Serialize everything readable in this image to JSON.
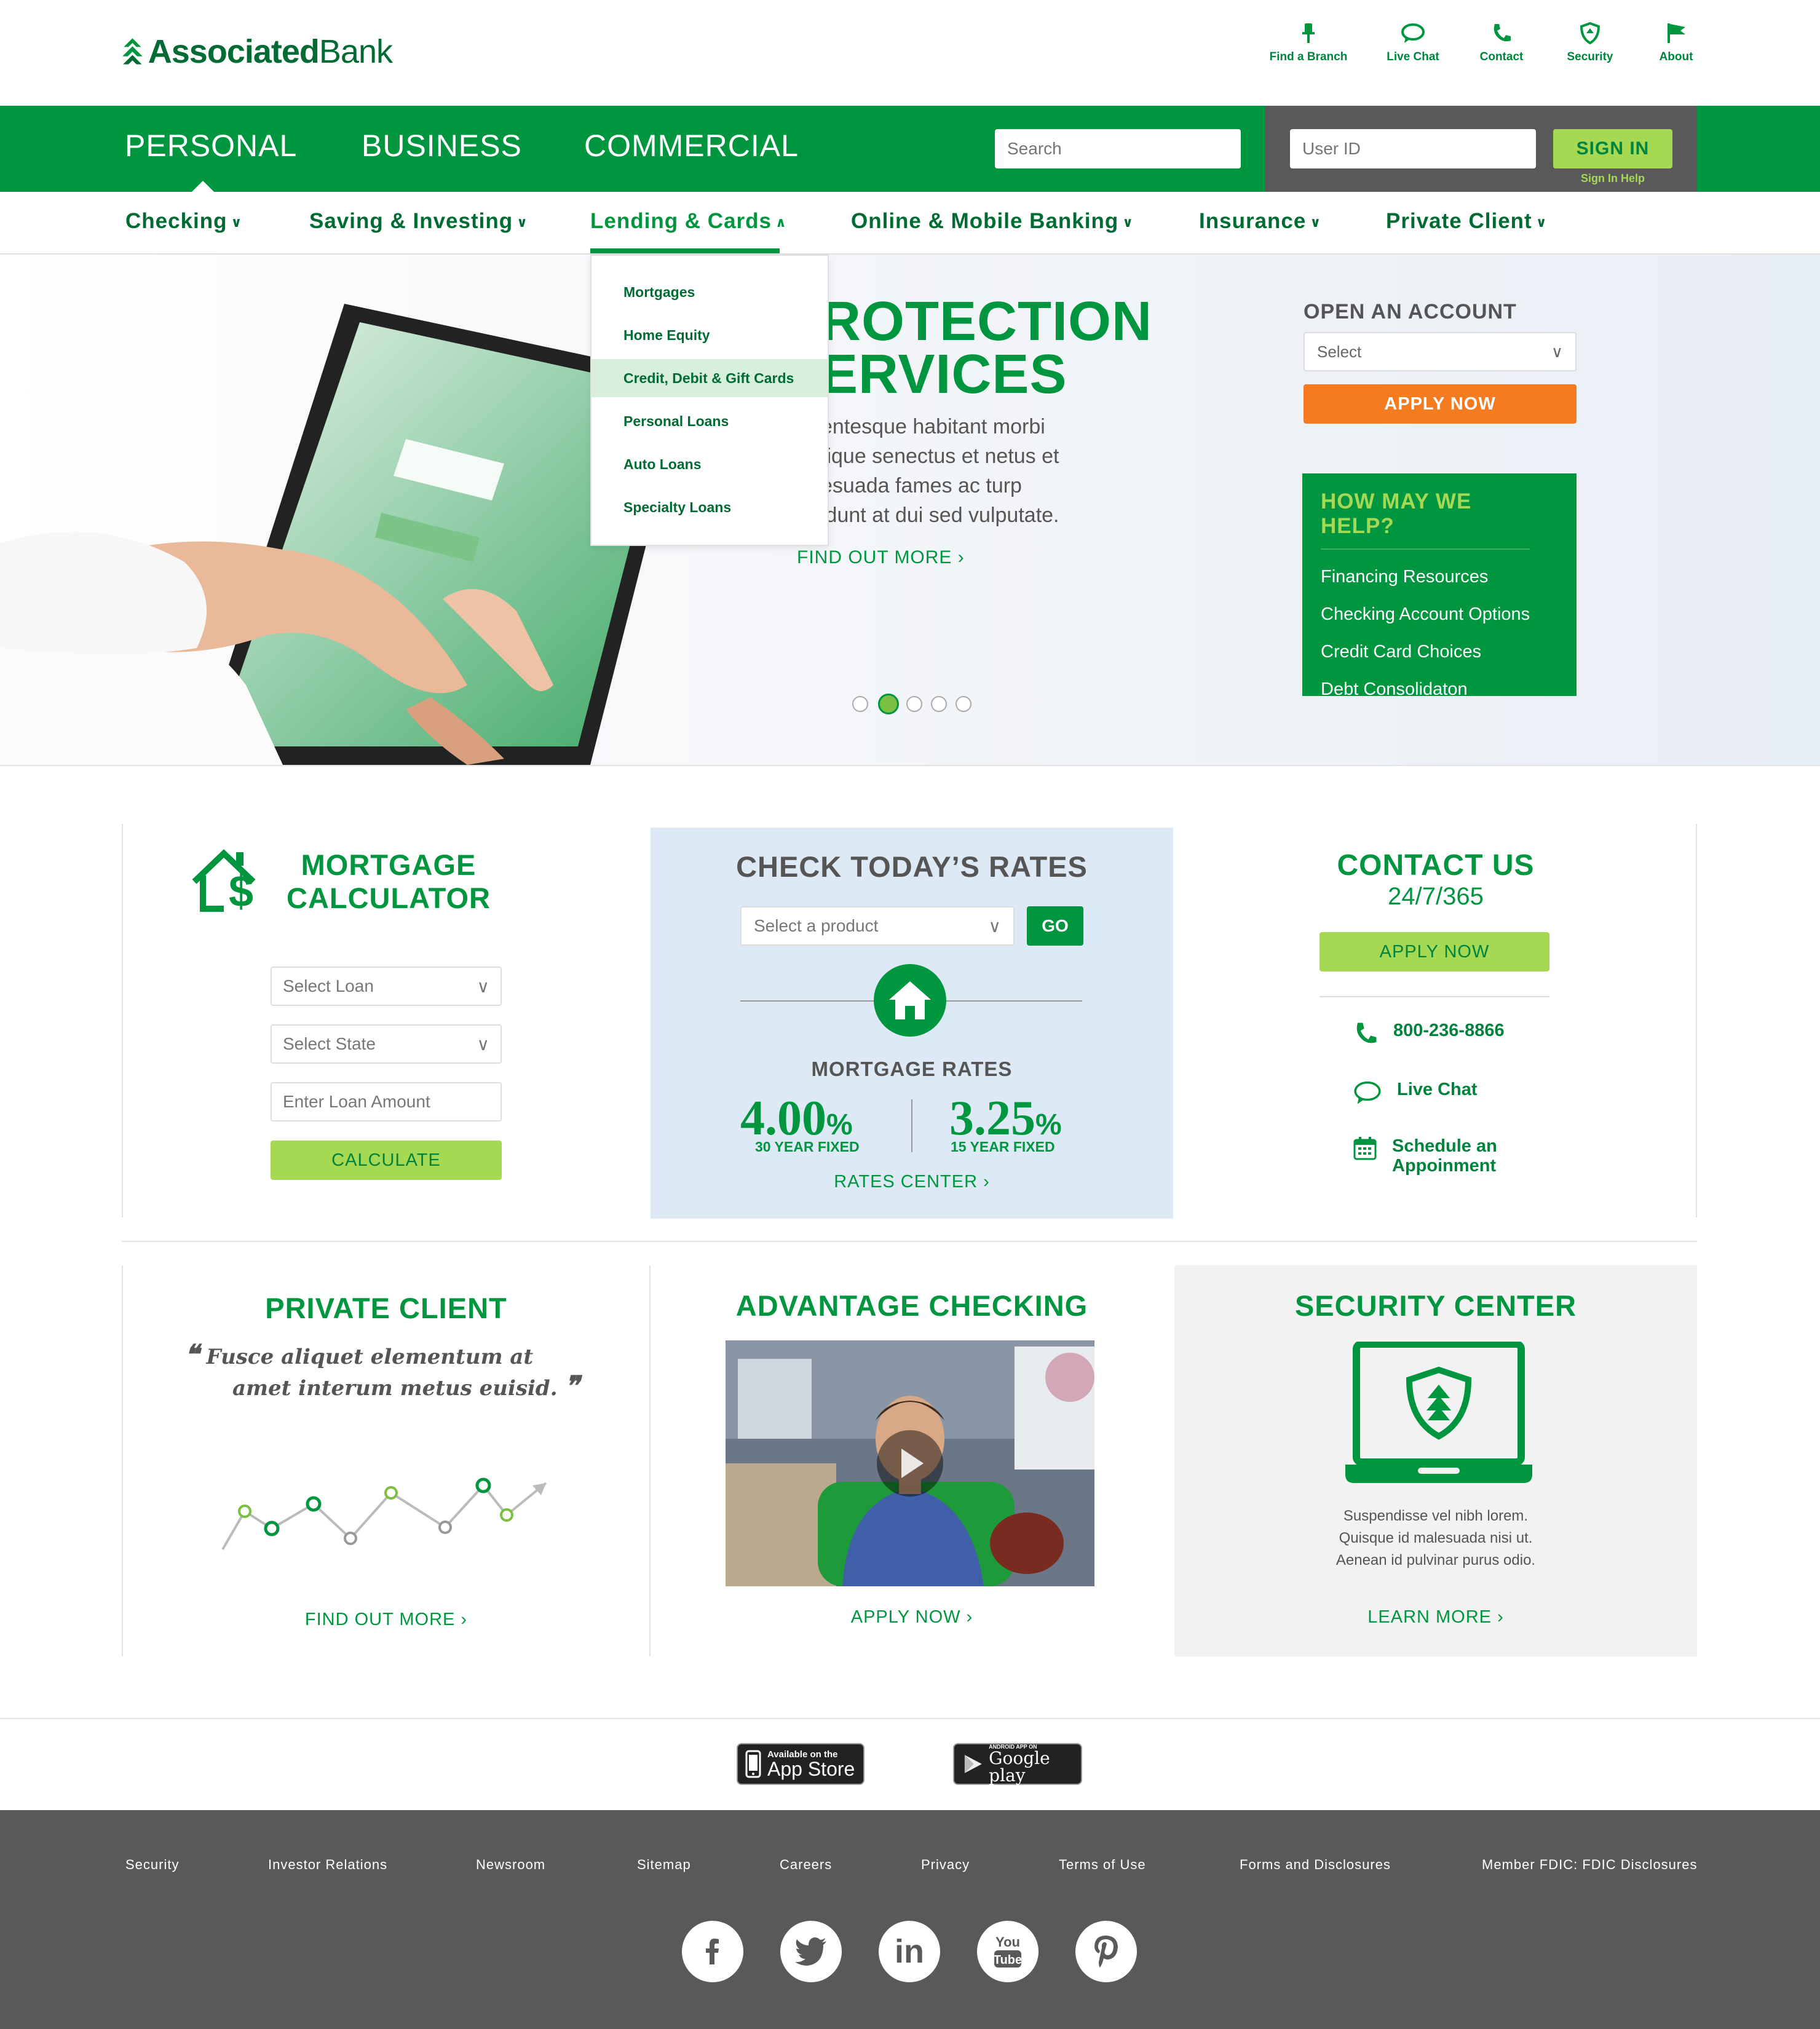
{
  "brand": {
    "name_bold": "Associated",
    "name_light": "Bank",
    "green": "#00963f",
    "dark_green": "#006b33",
    "lime": "#a5d853",
    "orange": "#f47b20",
    "gray": "#595959"
  },
  "utility_nav": [
    {
      "label": "Find a Branch",
      "icon": "pin-icon"
    },
    {
      "label": "Live Chat",
      "icon": "chat-icon"
    },
    {
      "label": "Contact",
      "icon": "phone-icon"
    },
    {
      "label": "Security",
      "icon": "shield-icon"
    },
    {
      "label": "About",
      "icon": "flag-icon"
    }
  ],
  "segments": [
    "PERSONAL",
    "BUSINESS",
    "COMMERCIAL"
  ],
  "search": {
    "placeholder": "Search"
  },
  "signin": {
    "userid_placeholder": "User ID",
    "button": "SIGN IN",
    "help": "Sign In Help"
  },
  "subnav": [
    {
      "label": "Checking",
      "chevron": "v"
    },
    {
      "label": "Saving & Investing",
      "chevron": "v"
    },
    {
      "label": "Lending & Cards",
      "chevron": "^"
    },
    {
      "label": "Online & Mobile Banking",
      "chevron": "v"
    },
    {
      "label": "Insurance",
      "chevron": "v"
    },
    {
      "label": "Private Client",
      "chevron": "v"
    }
  ],
  "dropdown": [
    "Mortgages",
    "Home Equity",
    "Credit, Debit & Gift Cards",
    "Personal Loans",
    "Auto Loans",
    "Specialty Loans"
  ],
  "hero": {
    "title_line1": "ROTECTION",
    "title_line2": "ERVICES",
    "body": [
      "entesque habitant morbi",
      "tique senectus et netus et",
      "esuada fames ac turp",
      "idunt at dui sed vulputate."
    ],
    "link": "FIND OUT MORE",
    "slides_total": 5,
    "slide_active": 2
  },
  "open_account": {
    "title": "OPEN AN ACCOUNT",
    "select": "Select",
    "button": "APPLY NOW"
  },
  "help": {
    "title": "HOW MAY WE HELP?",
    "links": [
      "Financing Resources",
      "Checking Account Options",
      "Credit Card Choices",
      "Debt Consolidaton"
    ]
  },
  "mortgage_calc": {
    "title_line1": "MORTGAGE",
    "title_line2": "CALCULATOR",
    "loan_select": "Select Loan",
    "state_select": "Select State",
    "amount_placeholder": "Enter Loan Amount",
    "button": "CALCULATE"
  },
  "rates": {
    "title": "CHECK TODAY’S RATES",
    "product_select": "Select a product",
    "go": "GO",
    "subtitle": "MORTGAGE RATES",
    "rate1": "4.00",
    "rate1_unit": "%",
    "rate1_label": "30 YEAR FIXED",
    "rate2": "3.25",
    "rate2_unit": "%",
    "rate2_label": "15 YEAR FIXED",
    "link": "RATES CENTER"
  },
  "contact": {
    "title": "CONTACT US",
    "sub": "24/7/365",
    "button": "APPLY NOW",
    "phone": "800-236-8866",
    "chat": "Live Chat",
    "schedule_line1": "Schedule an",
    "schedule_line2": "Appoinment"
  },
  "private_client": {
    "title": "PRIVATE CLIENT",
    "quote_line1": "Fusce aliquet elementum at",
    "quote_line2": "amet interum metus euisid.",
    "link": "FIND OUT MORE"
  },
  "advantage": {
    "title": "ADVANTAGE CHECKING",
    "link": "APPLY NOW"
  },
  "security_center": {
    "title": "SECURITY CENTER",
    "text": [
      "Suspendisse vel nibh lorem.",
      "Quisque id malesuada nisi ut.",
      "Aenean id pulvinar purus odio."
    ],
    "link": "LEARN MORE"
  },
  "apps": {
    "apple_small": "Available on the",
    "apple_big": "App Store",
    "google_small": "ANDROID APP ON",
    "google_big": "Google play"
  },
  "footer_links": [
    "Security",
    "Investor Relations",
    "Newsroom",
    "Sitemap",
    "Careers",
    "Privacy",
    "Terms of Use",
    "Forms and Disclosures",
    "Member FDIC: FDIC Disclosures"
  ],
  "social": [
    "facebook-icon",
    "twitter-icon",
    "linkedin-icon",
    "youtube-icon",
    "pinterest-icon"
  ]
}
